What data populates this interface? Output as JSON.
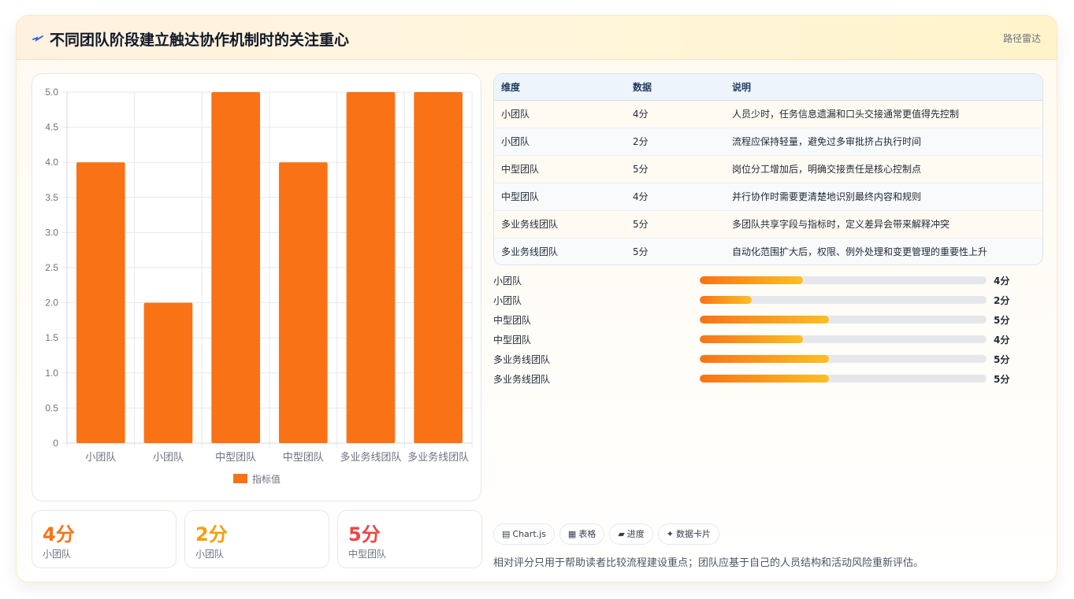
{
  "header": {
    "title": "不同团队阶段建立触达协作机制时的关注重心",
    "badge": "路径雷达"
  },
  "chart_data": {
    "type": "bar",
    "categories": [
      "小团队",
      "小团队",
      "中型团队",
      "中型团队",
      "多业务线团队",
      "多业务线团队"
    ],
    "series": [
      {
        "name": "指标值",
        "values": [
          4,
          2,
          5,
          4,
          5,
          5
        ]
      }
    ],
    "ylim": [
      0,
      5.0
    ],
    "yticks": [
      "0",
      "0.5",
      "1.0",
      "1.5",
      "2.0",
      "2.5",
      "3.0",
      "3.5",
      "4.0",
      "4.5",
      "5.0"
    ],
    "grid": true,
    "legend": "bottom",
    "bar_color": "#f97316"
  },
  "stats": [
    {
      "value": "4分",
      "label": "小团队",
      "color": "#f97316"
    },
    {
      "value": "2分",
      "label": "小团队",
      "color": "#f59e0b"
    },
    {
      "value": "5分",
      "label": "中型团队",
      "color": "#ef4444"
    }
  ],
  "table": {
    "headers": [
      "维度",
      "数据",
      "说明"
    ],
    "rows": [
      [
        "小团队",
        "4分",
        "人员少时，任务信息遗漏和口头交接通常更值得先控制"
      ],
      [
        "小团队",
        "2分",
        "流程应保持轻量，避免过多审批挤占执行时间"
      ],
      [
        "中型团队",
        "5分",
        "岗位分工增加后，明确交接责任是核心控制点"
      ],
      [
        "中型团队",
        "4分",
        "并行协作时需要更清楚地识别最终内容和规则"
      ],
      [
        "多业务线团队",
        "5分",
        "多团队共享字段与指标时，定义差异会带来解释冲突"
      ],
      [
        "多业务线团队",
        "5分",
        "自动化范围扩大后，权限、例外处理和变更管理的重要性上升"
      ]
    ]
  },
  "progress": [
    {
      "label": "小团队",
      "value_text": "4分",
      "fraction": 0.36
    },
    {
      "label": "小团队",
      "value_text": "2分",
      "fraction": 0.18
    },
    {
      "label": "中型团队",
      "value_text": "5分",
      "fraction": 0.45
    },
    {
      "label": "中型团队",
      "value_text": "4分",
      "fraction": 0.36
    },
    {
      "label": "多业务线团队",
      "value_text": "5分",
      "fraction": 0.45
    },
    {
      "label": "多业务线团队",
      "value_text": "5分",
      "fraction": 0.45
    }
  ],
  "tags": [
    {
      "icon": "chart-icon",
      "glyph": "▤",
      "label": "Chart.js"
    },
    {
      "icon": "table-icon",
      "glyph": "▦",
      "label": "表格"
    },
    {
      "icon": "progress-icon",
      "glyph": "▰",
      "label": "进度"
    },
    {
      "icon": "card-icon",
      "glyph": "✦",
      "label": "数据卡片"
    }
  ],
  "note": "相对评分只用于帮助读者比较流程建设重点；团队应基于自己的人员结构和活动风险重新评估。"
}
